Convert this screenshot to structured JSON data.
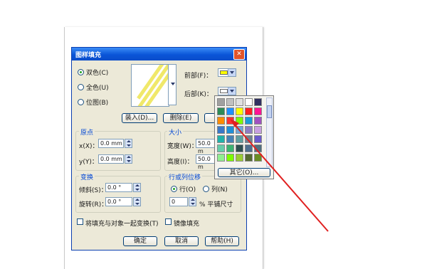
{
  "dialog": {
    "title": "图样填充",
    "close_label": "✕",
    "mode": {
      "two_color": "双色(C)",
      "full_color": "全色(U)",
      "bitmap": "位图(B)",
      "selected": "two_color"
    },
    "front_label": "前部(F)：",
    "back_label": "后部(K)：",
    "front_color": "#ffff00",
    "back_color": "#ffffff",
    "load_button": "装入(D)...",
    "delete_button": "删除(E)",
    "origin": {
      "title": "原点",
      "x_label": "x(X)：",
      "x_value": "0.0 mm",
      "y_label": "y(Y)：",
      "y_value": "0.0 mm"
    },
    "size": {
      "title": "大小",
      "width_label": "宽度(W)：",
      "width_value": "50.0 m",
      "height_label": "高度(I)：",
      "height_value": "50.0 m"
    },
    "transform": {
      "title": "变换",
      "skew_label": "倾斜(S)：",
      "skew_value": "0.0 °",
      "rotate_label": "旋转(R)：",
      "rotate_value": "0.0 °"
    },
    "offset": {
      "title": "行或列位移",
      "row_label": "行(O)",
      "col_label": "列(N)",
      "value": "0",
      "unit_label": "% 平铺尺寸"
    },
    "transform_with_object_label": "将填充与对象一起变换(T)",
    "mirror_fill_label": "镜像填充",
    "ok_button": "确定",
    "cancel_button": "取消",
    "help_button": "帮助(H)"
  },
  "palette": {
    "colors": [
      "#a0a0a0",
      "#c0c0c0",
      "#e0e0e0",
      "#ffffff",
      "#303060",
      "#2e8b57",
      "#1e90ff",
      "#ffff00",
      "#ff2020",
      "#ff1493",
      "#ff8c00",
      "#ff3030",
      "#7fff00",
      "#1a9bd7",
      "#a050c0",
      "#3a78c8",
      "#1f8fd8",
      "#6fa8dc",
      "#8e7cc3",
      "#c8a0e0",
      "#20b2aa",
      "#4682b4",
      "#5f9ea0",
      "#708090",
      "#6a5acd",
      "#66cdaa",
      "#3cb371",
      "#2f4f4f",
      "#4f6f8f",
      "#507080",
      "#90ee90",
      "#7cfc00",
      "#9acd32",
      "#556b2f",
      "#6b8e23"
    ],
    "other_button": "其它(O)..."
  }
}
